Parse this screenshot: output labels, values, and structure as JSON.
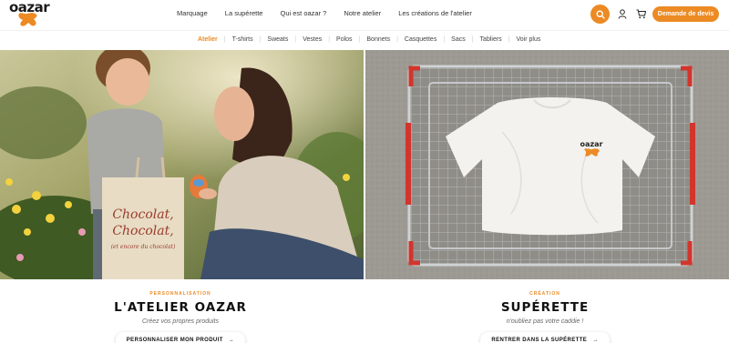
{
  "brand": {
    "name": "oazar",
    "accent": "#ec8a24"
  },
  "nav": {
    "items": [
      "Marquage",
      "La supérette",
      "Qui est oazar ?",
      "Notre atelier",
      "Les créations de l'atelier"
    ]
  },
  "header": {
    "search_icon": "search-icon",
    "user_icon": "user-icon",
    "cart_icon": "cart-icon",
    "quote_label": "Demande de devis"
  },
  "categories": {
    "items": [
      "Atelier",
      "T-shirts",
      "Sweats",
      "Vestes",
      "Polos",
      "Bonnets",
      "Casquettes",
      "Sacs",
      "Tabliers",
      "Voir plus"
    ],
    "active": "Atelier"
  },
  "hero_left": {
    "bag_line1": "Chocolat,",
    "bag_line2": "Chocolat,",
    "bag_line3": "(et encore du chocolat)"
  },
  "hero_right": {
    "shirt_logo": "oazar"
  },
  "sections": {
    "left": {
      "kicker": "PERSONNALISATION",
      "title": "L'ATELIER OAZAR",
      "subtitle": "Créez vos propres produits",
      "cta": "PERSONNALISER MON PRODUIT"
    },
    "right": {
      "kicker": "CRÉATION",
      "title": "SUPÉRETTE",
      "subtitle": "n'oubliez pas votre caddie !",
      "cta": "RENTRER DANS LA SUPÉRETTE"
    }
  }
}
